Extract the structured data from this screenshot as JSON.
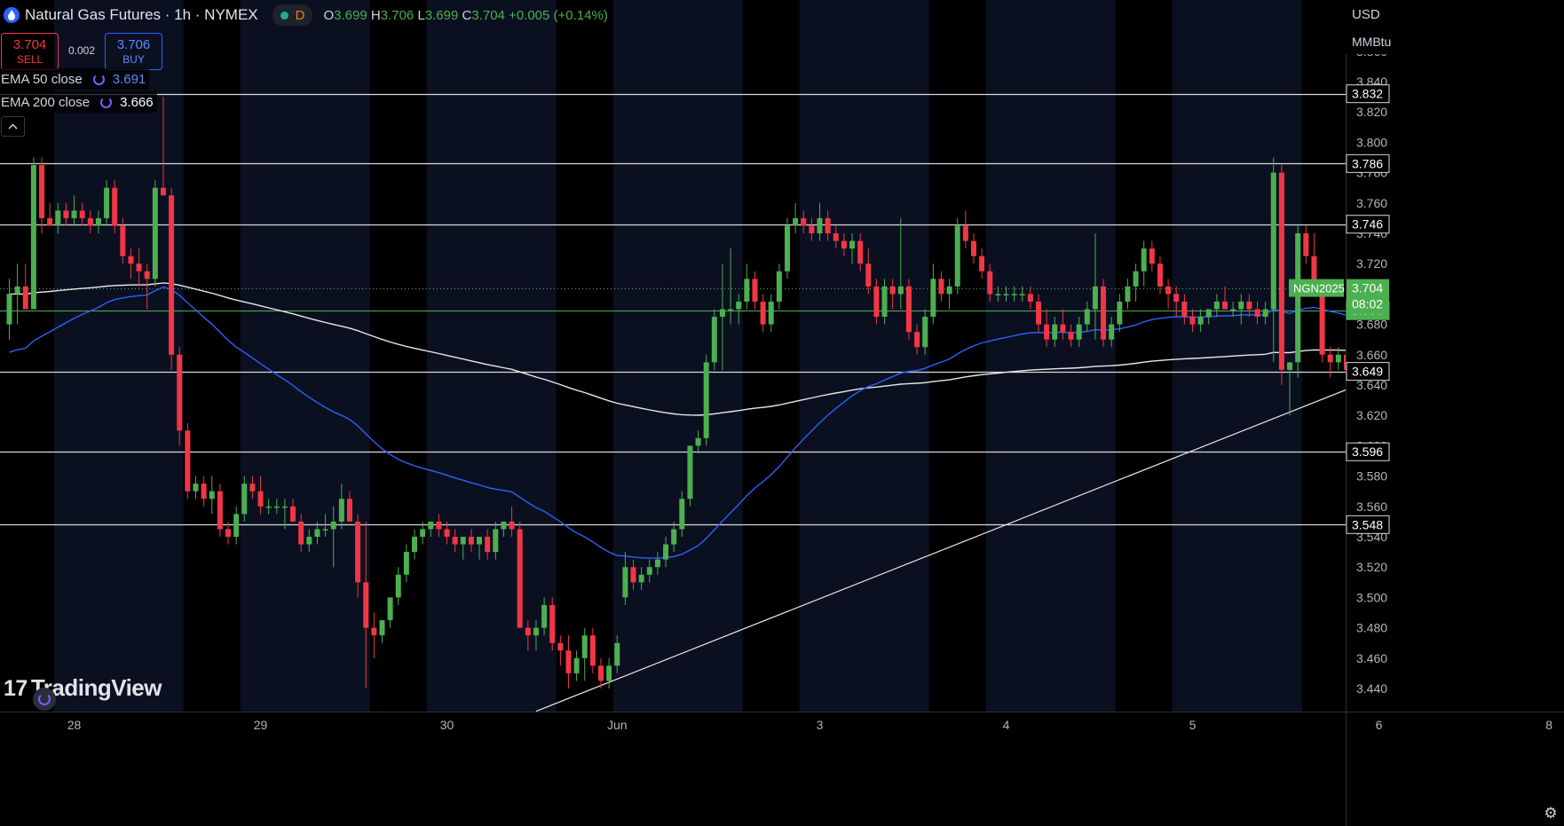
{
  "header": {
    "symbol_title": "Natural Gas Futures · 1h · NYMEX",
    "pill_letter": "D",
    "ohlc": {
      "o_label": "O",
      "o": "3.699",
      "h_label": "H",
      "h": "3.706",
      "l_label": "L",
      "l": "3.699",
      "c_label": "C",
      "c": "3.704",
      "change": "+0.005 (+0.14%)"
    }
  },
  "trade": {
    "sell_price": "3.704",
    "sell_label": "SELL",
    "spread": "0.002",
    "buy_price": "3.706",
    "buy_label": "BUY"
  },
  "indicators": [
    {
      "label": "EMA 50 close",
      "value": "3.691",
      "color": "#2962ff"
    },
    {
      "label": "EMA 200 close",
      "value": "3.666",
      "color": "#ffffff"
    }
  ],
  "right_toolbar": {
    "currency": "USD",
    "unit": "MMBtu"
  },
  "branding": {
    "logo_text": "TradingView"
  },
  "chart_data": {
    "type": "candlestick",
    "symbol": "NGN2025",
    "interval": "1h",
    "ylim": [
      3.425,
      3.875
    ],
    "y_ticks": [
      3.44,
      3.46,
      3.48,
      3.5,
      3.52,
      3.54,
      3.56,
      3.58,
      3.6,
      3.62,
      3.64,
      3.66,
      3.68,
      3.7,
      3.72,
      3.74,
      3.76,
      3.78,
      3.8,
      3.82,
      3.84,
      3.86
    ],
    "x_labels": [
      {
        "label": "28",
        "bar": 8
      },
      {
        "label": "29",
        "bar": 31
      },
      {
        "label": "30",
        "bar": 54
      },
      {
        "label": "Jun",
        "bar": 75
      },
      {
        "label": "3",
        "bar": 100
      },
      {
        "label": "4",
        "bar": 123
      },
      {
        "label": "5",
        "bar": 146
      },
      {
        "label": "6",
        "bar": 169
      },
      {
        "label": "8",
        "bar": 190
      }
    ],
    "horizontal_levels": [
      {
        "value": 3.832,
        "label": "3.832"
      },
      {
        "value": 3.786,
        "label": "3.786"
      },
      {
        "value": 3.746,
        "label": "3.746"
      },
      {
        "value": 3.649,
        "label": "3.649"
      },
      {
        "value": 3.596,
        "label": "3.596"
      },
      {
        "value": 3.548,
        "label": "3.548"
      }
    ],
    "green_level": {
      "value": 3.689,
      "label": "3.689"
    },
    "last_price": {
      "value": 3.704,
      "label": "3.704",
      "countdown": "08:02",
      "tag": "NGN2025"
    },
    "trendline": {
      "start": {
        "bar": 65,
        "price": 3.425
      },
      "end": {
        "bar": 190,
        "price": 3.69
      }
    },
    "session_bands": [
      {
        "from_bar": 5.5,
        "to_bar": 21.5
      },
      {
        "from_bar": 28.5,
        "to_bar": 44.5
      },
      {
        "from_bar": 51.5,
        "to_bar": 67.5
      },
      {
        "from_bar": 74.5,
        "to_bar": 90.5
      },
      {
        "from_bar": 97.5,
        "to_bar": 113.5
      },
      {
        "from_bar": 120.5,
        "to_bar": 136.5
      },
      {
        "from_bar": 143.5,
        "to_bar": 159.5
      },
      {
        "from_bar": 166.5,
        "to_bar": 173.5
      }
    ],
    "candles": [
      [
        3.68,
        3.71,
        3.67,
        3.7
      ],
      [
        3.7,
        3.72,
        3.68,
        3.705
      ],
      [
        3.705,
        3.72,
        3.69,
        3.69
      ],
      [
        3.69,
        3.79,
        3.69,
        3.785
      ],
      [
        3.785,
        3.79,
        3.74,
        3.75
      ],
      [
        3.75,
        3.76,
        3.745,
        3.745
      ],
      [
        3.745,
        3.76,
        3.74,
        3.755
      ],
      [
        3.755,
        3.76,
        3.745,
        3.75
      ],
      [
        3.75,
        3.765,
        3.745,
        3.755
      ],
      [
        3.755,
        3.76,
        3.745,
        3.75
      ],
      [
        3.75,
        3.755,
        3.74,
        3.745
      ],
      [
        3.745,
        3.755,
        3.74,
        3.75
      ],
      [
        3.75,
        3.775,
        3.745,
        3.77
      ],
      [
        3.77,
        3.775,
        3.74,
        3.745
      ],
      [
        3.745,
        3.75,
        3.72,
        3.725
      ],
      [
        3.725,
        3.73,
        3.71,
        3.72
      ],
      [
        3.72,
        3.73,
        3.705,
        3.715
      ],
      [
        3.715,
        3.72,
        3.69,
        3.71
      ],
      [
        3.71,
        3.775,
        3.705,
        3.77
      ],
      [
        3.77,
        3.83,
        3.765,
        3.765
      ],
      [
        3.765,
        3.77,
        3.65,
        3.66
      ],
      [
        3.66,
        3.665,
        3.6,
        3.61
      ],
      [
        3.61,
        3.615,
        3.565,
        3.57
      ],
      [
        3.57,
        3.58,
        3.565,
        3.575
      ],
      [
        3.575,
        3.58,
        3.56,
        3.565
      ],
      [
        3.565,
        3.58,
        3.555,
        3.57
      ],
      [
        3.57,
        3.575,
        3.54,
        3.545
      ],
      [
        3.545,
        3.55,
        3.535,
        3.54
      ],
      [
        3.54,
        3.56,
        3.535,
        3.555
      ],
      [
        3.555,
        3.58,
        3.55,
        3.575
      ],
      [
        3.575,
        3.58,
        3.565,
        3.57
      ],
      [
        3.57,
        3.58,
        3.555,
        3.56
      ],
      [
        3.56,
        3.565,
        3.555,
        3.56
      ],
      [
        3.56,
        3.565,
        3.555,
        3.56
      ],
      [
        3.56,
        3.565,
        3.545,
        3.56
      ],
      [
        3.56,
        3.565,
        3.55,
        3.55
      ],
      [
        3.55,
        3.555,
        3.53,
        3.535
      ],
      [
        3.535,
        3.545,
        3.53,
        3.54
      ],
      [
        3.54,
        3.55,
        3.535,
        3.545
      ],
      [
        3.545,
        3.555,
        3.54,
        3.545
      ],
      [
        3.545,
        3.56,
        3.52,
        3.55
      ],
      [
        3.55,
        3.575,
        3.545,
        3.565
      ],
      [
        3.565,
        3.57,
        3.55,
        3.55
      ],
      [
        3.55,
        3.555,
        3.5,
        3.51
      ],
      [
        3.51,
        3.55,
        3.44,
        3.48
      ],
      [
        3.48,
        3.49,
        3.46,
        3.475
      ],
      [
        3.475,
        3.485,
        3.47,
        3.485
      ],
      [
        3.485,
        3.5,
        3.48,
        3.5
      ],
      [
        3.5,
        3.52,
        3.495,
        3.515
      ],
      [
        3.515,
        3.535,
        3.51,
        3.53
      ],
      [
        3.53,
        3.545,
        3.525,
        3.54
      ],
      [
        3.54,
        3.55,
        3.535,
        3.545
      ],
      [
        3.545,
        3.55,
        3.54,
        3.55
      ],
      [
        3.55,
        3.555,
        3.54,
        3.545
      ],
      [
        3.545,
        3.55,
        3.535,
        3.54
      ],
      [
        3.54,
        3.545,
        3.53,
        3.535
      ],
      [
        3.535,
        3.54,
        3.525,
        3.54
      ],
      [
        3.54,
        3.545,
        3.53,
        3.535
      ],
      [
        3.535,
        3.54,
        3.525,
        3.54
      ],
      [
        3.54,
        3.545,
        3.525,
        3.53
      ],
      [
        3.53,
        3.55,
        3.525,
        3.545
      ],
      [
        3.545,
        3.55,
        3.54,
        3.55
      ],
      [
        3.55,
        3.56,
        3.54,
        3.545
      ],
      [
        3.545,
        3.55,
        3.48,
        3.48
      ],
      [
        3.48,
        3.485,
        3.465,
        3.475
      ],
      [
        3.475,
        3.485,
        3.465,
        3.48
      ],
      [
        3.48,
        3.5,
        3.475,
        3.495
      ],
      [
        3.495,
        3.5,
        3.465,
        3.47
      ],
      [
        3.47,
        3.475,
        3.455,
        3.465
      ],
      [
        3.465,
        3.475,
        3.44,
        3.45
      ],
      [
        3.45,
        3.465,
        3.445,
        3.46
      ],
      [
        3.46,
        3.48,
        3.445,
        3.475
      ],
      [
        3.475,
        3.48,
        3.45,
        3.455
      ],
      [
        3.455,
        3.46,
        3.44,
        3.445
      ],
      [
        3.445,
        3.46,
        3.44,
        3.455
      ],
      [
        3.455,
        3.475,
        3.45,
        3.47
      ],
      [
        3.5,
        3.53,
        3.495,
        3.52
      ],
      [
        3.52,
        3.525,
        3.505,
        3.51
      ],
      [
        3.51,
        3.52,
        3.505,
        3.515
      ],
      [
        3.515,
        3.525,
        3.51,
        3.52
      ],
      [
        3.52,
        3.53,
        3.515,
        3.525
      ],
      [
        3.525,
        3.54,
        3.52,
        3.535
      ],
      [
        3.535,
        3.55,
        3.53,
        3.545
      ],
      [
        3.545,
        3.57,
        3.54,
        3.565
      ],
      [
        3.565,
        3.6,
        3.56,
        3.6
      ],
      [
        3.6,
        3.61,
        3.595,
        3.605
      ],
      [
        3.605,
        3.66,
        3.6,
        3.655
      ],
      [
        3.655,
        3.69,
        3.65,
        3.685
      ],
      [
        3.685,
        3.72,
        3.65,
        3.69
      ],
      [
        3.69,
        3.73,
        3.68,
        3.69
      ],
      [
        3.69,
        3.7,
        3.68,
        3.695
      ],
      [
        3.695,
        3.72,
        3.69,
        3.71
      ],
      [
        3.71,
        3.715,
        3.69,
        3.695
      ],
      [
        3.695,
        3.7,
        3.675,
        3.68
      ],
      [
        3.68,
        3.7,
        3.675,
        3.695
      ],
      [
        3.695,
        3.72,
        3.69,
        3.715
      ],
      [
        3.715,
        3.75,
        3.71,
        3.745
      ],
      [
        3.745,
        3.76,
        3.74,
        3.75
      ],
      [
        3.75,
        3.755,
        3.74,
        3.745
      ],
      [
        3.745,
        3.75,
        3.735,
        3.74
      ],
      [
        3.74,
        3.76,
        3.735,
        3.75
      ],
      [
        3.75,
        3.755,
        3.735,
        3.74
      ],
      [
        3.74,
        3.745,
        3.73,
        3.735
      ],
      [
        3.735,
        3.74,
        3.725,
        3.73
      ],
      [
        3.73,
        3.74,
        3.72,
        3.735
      ],
      [
        3.735,
        3.74,
        3.715,
        3.72
      ],
      [
        3.72,
        3.73,
        3.7,
        3.705
      ],
      [
        3.705,
        3.71,
        3.68,
        3.685
      ],
      [
        3.685,
        3.71,
        3.68,
        3.705
      ],
      [
        3.705,
        3.71,
        3.69,
        3.7
      ],
      [
        3.7,
        3.75,
        3.69,
        3.705
      ],
      [
        3.705,
        3.71,
        3.67,
        3.675
      ],
      [
        3.675,
        3.68,
        3.66,
        3.665
      ],
      [
        3.665,
        3.69,
        3.66,
        3.685
      ],
      [
        3.685,
        3.72,
        3.68,
        3.71
      ],
      [
        3.71,
        3.715,
        3.695,
        3.7
      ],
      [
        3.7,
        3.71,
        3.69,
        3.705
      ],
      [
        3.705,
        3.75,
        3.7,
        3.745
      ],
      [
        3.745,
        3.755,
        3.73,
        3.735
      ],
      [
        3.735,
        3.74,
        3.72,
        3.725
      ],
      [
        3.725,
        3.73,
        3.71,
        3.715
      ],
      [
        3.715,
        3.72,
        3.695,
        3.7
      ],
      [
        3.7,
        3.705,
        3.695,
        3.7
      ],
      [
        3.7,
        3.705,
        3.695,
        3.7
      ],
      [
        3.7,
        3.705,
        3.695,
        3.7
      ],
      [
        3.7,
        3.705,
        3.695,
        3.7
      ],
      [
        3.7,
        3.705,
        3.69,
        3.695
      ],
      [
        3.695,
        3.7,
        3.675,
        3.68
      ],
      [
        3.68,
        3.69,
        3.665,
        3.67
      ],
      [
        3.67,
        3.685,
        3.665,
        3.68
      ],
      [
        3.68,
        3.69,
        3.67,
        3.675
      ],
      [
        3.675,
        3.68,
        3.665,
        3.67
      ],
      [
        3.67,
        3.685,
        3.665,
        3.68
      ],
      [
        3.68,
        3.695,
        3.675,
        3.69
      ],
      [
        3.69,
        3.74,
        3.67,
        3.705
      ],
      [
        3.705,
        3.71,
        3.665,
        3.67
      ],
      [
        3.67,
        3.685,
        3.665,
        3.68
      ],
      [
        3.68,
        3.7,
        3.675,
        3.695
      ],
      [
        3.695,
        3.71,
        3.69,
        3.705
      ],
      [
        3.705,
        3.72,
        3.695,
        3.715
      ],
      [
        3.715,
        3.735,
        3.705,
        3.73
      ],
      [
        3.73,
        3.735,
        3.715,
        3.72
      ],
      [
        3.72,
        3.725,
        3.7,
        3.705
      ],
      [
        3.705,
        3.71,
        3.69,
        3.7
      ],
      [
        3.7,
        3.705,
        3.685,
        3.695
      ],
      [
        3.695,
        3.7,
        3.68,
        3.685
      ],
      [
        3.685,
        3.69,
        3.675,
        3.68
      ],
      [
        3.68,
        3.69,
        3.675,
        3.685
      ],
      [
        3.685,
        3.69,
        3.68,
        3.69
      ],
      [
        3.69,
        3.7,
        3.685,
        3.695
      ],
      [
        3.695,
        3.705,
        3.69,
        3.69
      ],
      [
        3.69,
        3.695,
        3.685,
        3.69
      ],
      [
        3.69,
        3.7,
        3.68,
        3.695
      ],
      [
        3.695,
        3.7,
        3.685,
        3.69
      ],
      [
        3.69,
        3.695,
        3.68,
        3.685
      ],
      [
        3.685,
        3.695,
        3.68,
        3.69
      ],
      [
        3.69,
        3.79,
        3.655,
        3.78
      ],
      [
        3.78,
        3.785,
        3.64,
        3.65
      ],
      [
        3.65,
        3.655,
        3.62,
        3.655
      ],
      [
        3.655,
        3.745,
        3.645,
        3.74
      ],
      [
        3.74,
        3.745,
        3.72,
        3.725
      ],
      [
        3.725,
        3.74,
        3.7,
        3.705
      ],
      [
        3.705,
        3.71,
        3.655,
        3.66
      ],
      [
        3.66,
        3.665,
        3.645,
        3.655
      ],
      [
        3.655,
        3.665,
        3.65,
        3.66
      ],
      [
        3.66,
        3.665,
        3.645,
        3.65
      ],
      [
        3.65,
        3.66,
        3.645,
        3.655
      ],
      [
        3.655,
        3.67,
        3.65,
        3.665
      ],
      [
        3.665,
        3.68,
        3.66,
        3.675
      ],
      [
        3.675,
        3.69,
        3.67,
        3.685
      ],
      [
        3.685,
        3.7,
        3.68,
        3.695
      ],
      [
        3.695,
        3.705,
        3.69,
        3.7
      ],
      [
        3.7,
        3.705,
        3.695,
        3.7
      ],
      [
        3.699,
        3.706,
        3.699,
        3.704
      ]
    ]
  }
}
